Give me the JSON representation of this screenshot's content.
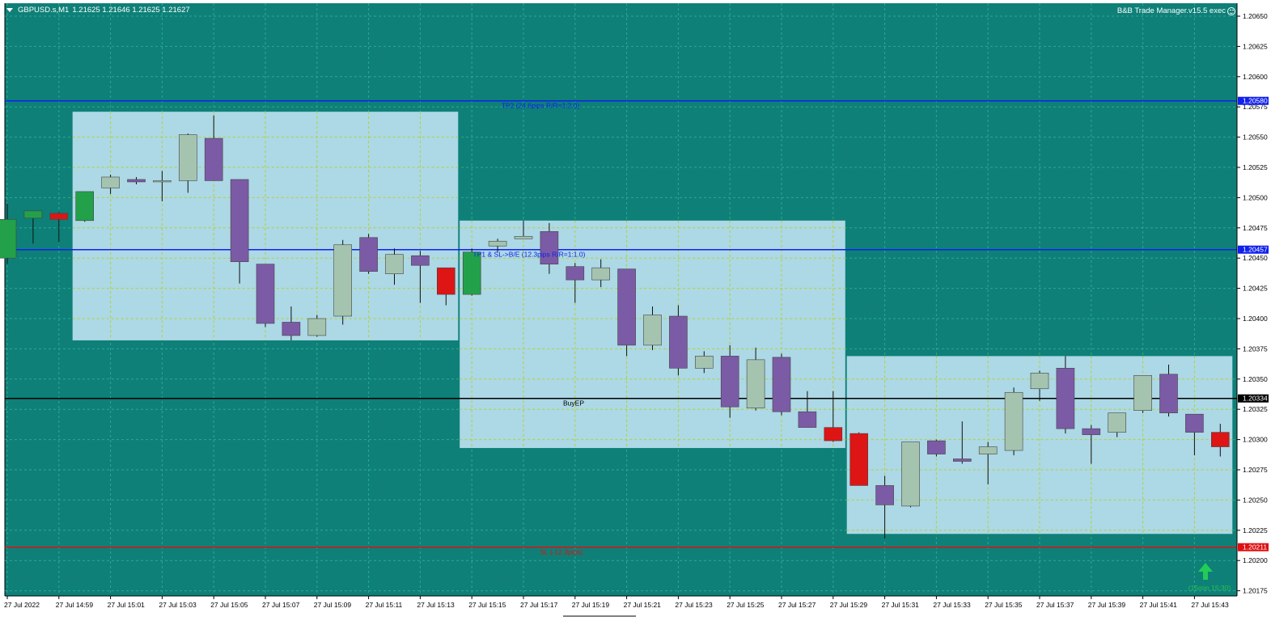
{
  "header": {
    "symbol": "GBPUSD.s,M1",
    "ohlc": "1.21625 1.21646 1.21625 1.21627"
  },
  "ea_label": "B&B Trade Manager.v15.5 exec",
  "colors": {
    "background": "#0e8078",
    "grid": "#2aa79d",
    "bull_body": "#a5c4b0",
    "bear_body": "#7b5ba5",
    "candle_outline": "#55406a",
    "box_fill": "#add8e6",
    "box_grid": "#b4d12e",
    "tp_line": "#1020ee",
    "entry_line": "#000000",
    "sl_line": "#dd1111",
    "green_candle": "#22a14a",
    "red_candle": "#dd1515",
    "arrow": "#22cc55"
  },
  "chart_data": {
    "type": "candlestick",
    "timeframe": "M1",
    "ylim": [
      1.20155,
      1.20673
    ],
    "y_ticks": [
      "1.20650",
      "1.20625",
      "1.20600",
      "1.20575",
      "1.20550",
      "1.20525",
      "1.20500",
      "1.20475",
      "1.20450",
      "1.20425",
      "1.20400",
      "1.20375",
      "1.20350",
      "1.20325",
      "1.20300",
      "1.20275",
      "1.20250",
      "1.20225",
      "1.20200",
      "1.20175"
    ],
    "x_ticks": [
      "27 Jul 2022",
      "27 Jul 14:59",
      "27 Jul 15:01",
      "27 Jul 15:03",
      "27 Jul 15:05",
      "27 Jul 15:07",
      "27 Jul 15:09",
      "27 Jul 15:11",
      "27 Jul 15:13",
      "27 Jul 15:15",
      "27 Jul 15:17",
      "27 Jul 15:19",
      "27 Jul 15:21",
      "27 Jul 15:23",
      "27 Jul 15:25",
      "27 Jul 15:27",
      "27 Jul 15:29",
      "27 Jul 15:31",
      "27 Jul 15:33",
      "27 Jul 15:35",
      "27 Jul 15:37",
      "27 Jul 15:39",
      "27 Jul 15:41",
      "27 Jul 15:43"
    ],
    "candles": [
      {
        "o": 1.2045,
        "h": 1.20495,
        "l": 1.20445,
        "c": 1.20482,
        "color": "green"
      },
      {
        "o": 1.20483,
        "h": 1.20488,
        "l": 1.20462,
        "c": 1.20489,
        "color": "green"
      },
      {
        "o": 1.20487,
        "h": 1.20488,
        "l": 1.20463,
        "c": 1.20482,
        "color": "red"
      },
      {
        "o": 1.20481,
        "h": 1.20505,
        "l": 1.2048,
        "c": 1.20505,
        "color": "green"
      },
      {
        "o": 1.20508,
        "h": 1.20519,
        "l": 1.20503,
        "c": 1.20517
      },
      {
        "o": 1.20515,
        "h": 1.20517,
        "l": 1.20511,
        "c": 1.20513
      },
      {
        "o": 1.20513,
        "h": 1.20522,
        "l": 1.20497,
        "c": 1.20514
      },
      {
        "o": 1.20514,
        "h": 1.20553,
        "l": 1.20504,
        "c": 1.20552
      },
      {
        "o": 1.20549,
        "h": 1.20568,
        "l": 1.20514,
        "c": 1.20514
      },
      {
        "o": 1.20515,
        "h": 1.20515,
        "l": 1.20429,
        "c": 1.20447
      },
      {
        "o": 1.20445,
        "h": 1.20445,
        "l": 1.20393,
        "c": 1.20396
      },
      {
        "o": 1.20397,
        "h": 1.2041,
        "l": 1.20382,
        "c": 1.20386
      },
      {
        "o": 1.20386,
        "h": 1.20403,
        "l": 1.20385,
        "c": 1.204
      },
      {
        "o": 1.20402,
        "h": 1.20465,
        "l": 1.20395,
        "c": 1.20461
      },
      {
        "o": 1.20467,
        "h": 1.2047,
        "l": 1.20437,
        "c": 1.20439
      },
      {
        "o": 1.20437,
        "h": 1.20458,
        "l": 1.20428,
        "c": 1.20453
      },
      {
        "o": 1.20452,
        "h": 1.20456,
        "l": 1.20413,
        "c": 1.20444
      },
      {
        "o": 1.20442,
        "h": 1.20442,
        "l": 1.20411,
        "c": 1.2042,
        "color": "red"
      },
      {
        "o": 1.2042,
        "h": 1.20458,
        "l": 1.20419,
        "c": 1.20455,
        "color": "green"
      },
      {
        "o": 1.2046,
        "h": 1.20466,
        "l": 1.20455,
        "c": 1.20464
      },
      {
        "o": 1.20466,
        "h": 1.20481,
        "l": 1.20466,
        "c": 1.20468
      },
      {
        "o": 1.20472,
        "h": 1.20479,
        "l": 1.20437,
        "c": 1.20445
      },
      {
        "o": 1.20443,
        "h": 1.20446,
        "l": 1.20413,
        "c": 1.20432
      },
      {
        "o": 1.20432,
        "h": 1.20449,
        "l": 1.20426,
        "c": 1.20442
      },
      {
        "o": 1.20441,
        "h": 1.20441,
        "l": 1.20369,
        "c": 1.20378
      },
      {
        "o": 1.20378,
        "h": 1.2041,
        "l": 1.20374,
        "c": 1.20403
      },
      {
        "o": 1.20402,
        "h": 1.20411,
        "l": 1.20353,
        "c": 1.20359
      },
      {
        "o": 1.20359,
        "h": 1.20373,
        "l": 1.20355,
        "c": 1.20369
      },
      {
        "o": 1.20369,
        "h": 1.20378,
        "l": 1.20318,
        "c": 1.20327
      },
      {
        "o": 1.20326,
        "h": 1.20376,
        "l": 1.20324,
        "c": 1.20366
      },
      {
        "o": 1.20368,
        "h": 1.20371,
        "l": 1.2032,
        "c": 1.20323
      },
      {
        "o": 1.20323,
        "h": 1.2034,
        "l": 1.20311,
        "c": 1.2031
      },
      {
        "o": 1.2031,
        "h": 1.2034,
        "l": 1.20298,
        "c": 1.20299,
        "color": "red"
      },
      {
        "o": 1.20305,
        "h": 1.20306,
        "l": 1.20262,
        "c": 1.20262,
        "color": "red"
      },
      {
        "o": 1.20262,
        "h": 1.2027,
        "l": 1.20218,
        "c": 1.20246
      },
      {
        "o": 1.20245,
        "h": 1.20298,
        "l": 1.20244,
        "c": 1.20298
      },
      {
        "o": 1.20299,
        "h": 1.203,
        "l": 1.20286,
        "c": 1.20288
      },
      {
        "o": 1.20284,
        "h": 1.20315,
        "l": 1.2028,
        "c": 1.20282
      },
      {
        "o": 1.20288,
        "h": 1.20298,
        "l": 1.20263,
        "c": 1.20294
      },
      {
        "o": 1.20291,
        "h": 1.20343,
        "l": 1.20287,
        "c": 1.20339
      },
      {
        "o": 1.20342,
        "h": 1.20357,
        "l": 1.20332,
        "c": 1.20355
      },
      {
        "o": 1.20359,
        "h": 1.20369,
        "l": 1.20305,
        "c": 1.20309
      },
      {
        "o": 1.20309,
        "h": 1.20312,
        "l": 1.2028,
        "c": 1.20304
      },
      {
        "o": 1.20306,
        "h": 1.20322,
        "l": 1.20302,
        "c": 1.20322
      },
      {
        "o": 1.20324,
        "h": 1.20353,
        "l": 1.20322,
        "c": 1.20353
      },
      {
        "o": 1.20354,
        "h": 1.20362,
        "l": 1.20319,
        "c": 1.20322
      },
      {
        "o": 1.20321,
        "h": 1.20321,
        "l": 1.20287,
        "c": 1.20306
      },
      {
        "o": 1.20306,
        "h": 1.20313,
        "l": 1.20286,
        "c": 1.20294,
        "color": "red"
      }
    ],
    "session_boxes": [
      {
        "from_index": 3,
        "to_index": 17,
        "high": 1.20571,
        "low": 1.20382
      },
      {
        "from_index": 18,
        "to_index": 32,
        "high": 1.20481,
        "low": 1.20293
      },
      {
        "from_index": 33,
        "to_index": 47,
        "high": 1.20369,
        "low": 1.20222
      }
    ],
    "levels": [
      {
        "price": 1.2058,
        "label": "TP2 (24.6pips R/R=1:2.0)",
        "axis_label": "1.20580",
        "color": "#1020ee"
      },
      {
        "price": 1.20457,
        "label": "TP1 & SL->B/E (12.3pips R/R=1:1.0)",
        "axis_label": "1.20457",
        "color": "#1020ee"
      },
      {
        "price": 1.20334,
        "label": "BuyEP",
        "axis_label": "1.20334",
        "color": "#000000"
      },
      {
        "price": 1.20211,
        "label": "SL (-12.3pips)",
        "axis_label": "1.20211",
        "color": "#dd1111"
      }
    ],
    "signal": {
      "label": "(15min 15:30)",
      "icon": "up-arrow-icon"
    },
    "grid": true
  }
}
